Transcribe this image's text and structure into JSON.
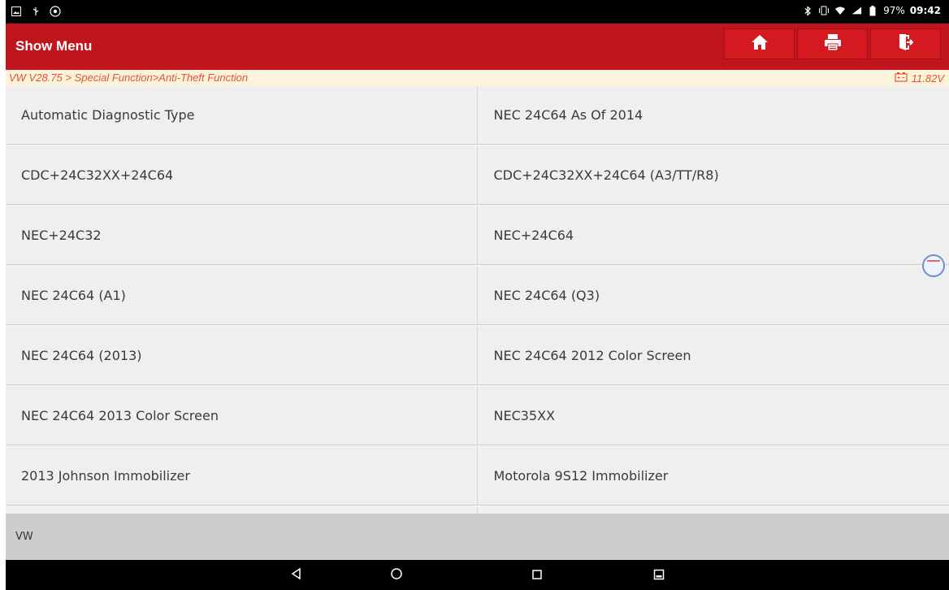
{
  "status_bar": {
    "battery_percent": "97%",
    "time": "09:42",
    "left_icons": [
      "gallery-icon",
      "usb-debug-icon",
      "camera-icon"
    ],
    "right_icons": [
      "bluetooth-icon",
      "vibrate-icon",
      "wifi-icon",
      "signal-icon",
      "battery-icon"
    ]
  },
  "header": {
    "title": "Show Menu",
    "buttons": [
      "home-icon",
      "print-icon",
      "exit-icon"
    ]
  },
  "breadcrumb": {
    "path": "VW V28.75 > Special Function>Anti-Theft Function",
    "voltage": "11.82V"
  },
  "menu": {
    "items": [
      "Automatic Diagnostic Type",
      "NEC 24C64 As Of 2014",
      "CDC+24C32XX+24C64",
      "CDC+24C32XX+24C64 (A3/TT/R8)",
      "NEC+24C32",
      "NEC+24C64",
      "NEC 24C64 (A1)",
      "NEC 24C64 (Q3)",
      "NEC 24C64 (2013)",
      "NEC 24C64 2012 Color Screen",
      "NEC 24C64 2013 Color Screen",
      "NEC35XX",
      "2013 Johnson Immobilizer",
      "Motorola 9S12 Immobilizer",
      "",
      ""
    ]
  },
  "footer": {
    "label": "VW"
  },
  "nav_bar": {
    "buttons": [
      "back-icon",
      "home-circle-icon",
      "recents-icon",
      "keyboard-icon"
    ]
  },
  "colors": {
    "header": "#c0151c",
    "breadcrumb_text": "#e4542a",
    "breadcrumb_bg": "#fbf3dc",
    "menu_bg": "#efefef",
    "footer_bg": "#cdcdcd"
  }
}
